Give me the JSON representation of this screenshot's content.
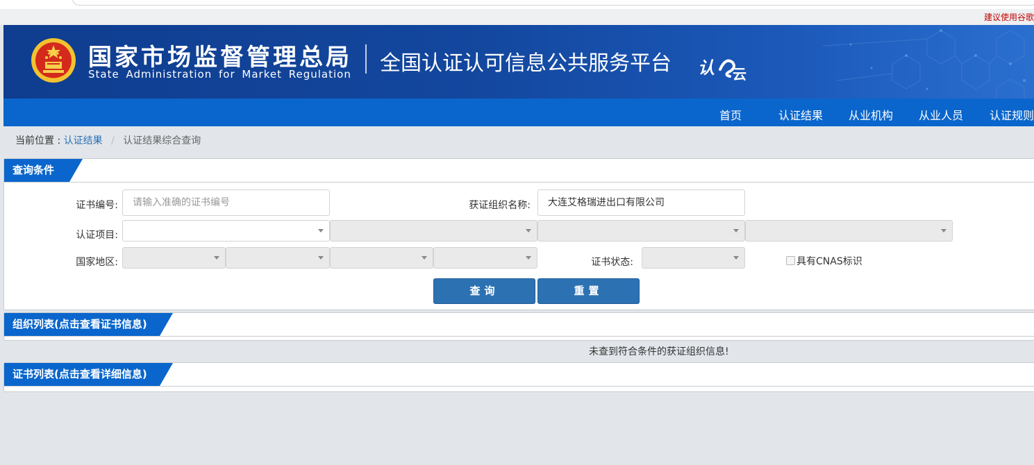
{
  "browser_notice": "建议使用谷歌",
  "header": {
    "agency_cn": "国家市场监督管理总局",
    "agency_en": "State Administration for Market Regulation",
    "platform_title": "全国认证认可信息公共服务平台",
    "cloud_logo_text": "认云",
    "emblem_icon": "national-emblem-icon",
    "colors": {
      "banner": "#13479e",
      "nav": "#0a66cc"
    }
  },
  "nav": {
    "items": [
      {
        "label": "首页"
      },
      {
        "label": "认证结果"
      },
      {
        "label": "从业机构"
      },
      {
        "label": "从业人员"
      },
      {
        "label": "认证规则"
      }
    ]
  },
  "breadcrumb": {
    "prefix": "当前位置 :",
    "link": "认证结果",
    "separator": "/",
    "current": "认证结果综合查询"
  },
  "query": {
    "title": "查询条件",
    "cert_no_label": "证书编号:",
    "cert_no_placeholder": "请输入准确的证书编号",
    "cert_no_value": "",
    "org_name_label": "获证组织名称:",
    "org_name_value": "大连艾格瑞进出口有限公司",
    "project_label": "认证项目:",
    "region_label": "国家地区:",
    "status_label": "证书状态:",
    "cnas_label": "具有CNAS标识",
    "cnas_checked": false,
    "search_button": "查询",
    "reset_button": "重置"
  },
  "org_list": {
    "title": "组织列表(点击查看证书信息)",
    "empty_message": "未查到符合条件的获证组织信息!"
  },
  "cert_list": {
    "title": "证书列表(点击查看详细信息)"
  }
}
